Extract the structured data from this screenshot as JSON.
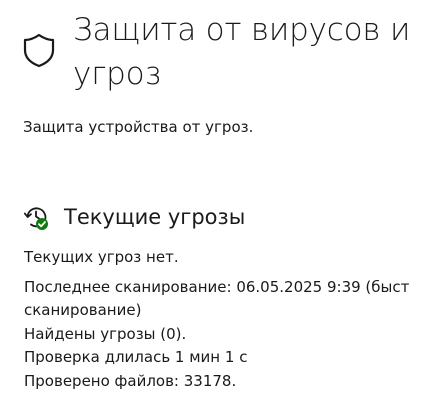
{
  "page": {
    "title": "Защита от вирусов и угроз",
    "subtitle": "Защита устройства от угроз.",
    "icons": [
      "shield-icon",
      "threat-history-icon"
    ]
  },
  "current_threats": {
    "title": "Текущие угрозы",
    "no_threats": "Текущих угроз нет.",
    "last_scan_line1": "Последнее сканирование: 06.05.2025 9:39 (быст",
    "last_scan_line2": "сканирование)",
    "threats_found": "Найдены угрозы (0).",
    "scan_duration": "Проверка длилась 1 мин 1 с",
    "files_scanned": "Проверено файлов: 33178."
  },
  "colors": {
    "text": "#1a1a1a",
    "status_green": "#107c10"
  }
}
